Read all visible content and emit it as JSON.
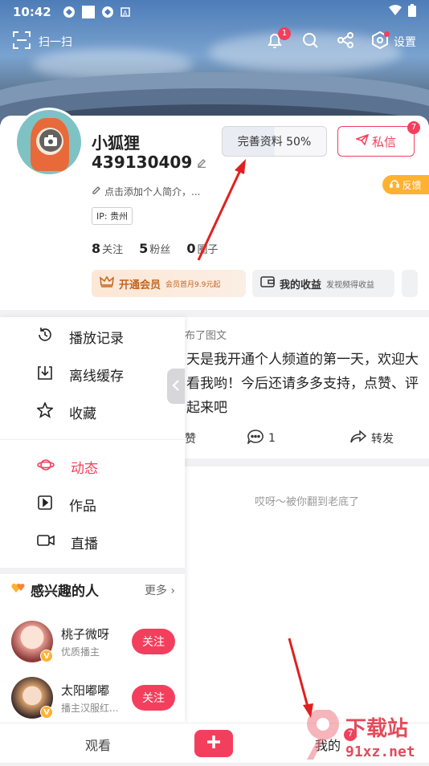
{
  "status_bar": {
    "time": "10:42"
  },
  "topbar": {
    "scan_label": "扫一扫",
    "notif_count": "1",
    "settings_label": "设置"
  },
  "profile": {
    "nickname": "小狐狸",
    "uid": "439130409",
    "bio_placeholder": "点击添加个人简介，...",
    "ip": "IP: 贵州",
    "complete_label": "完善资料 50%",
    "complete_progress": 0.5,
    "message_label": "私信",
    "message_badge": "7",
    "feedback_label": "反馈",
    "stats": [
      {
        "count": "8",
        "label": "关注"
      },
      {
        "count": "5",
        "label": "粉丝"
      },
      {
        "count": "0",
        "label": "圈子"
      }
    ],
    "vip": {
      "title": "开通会员",
      "subtitle": "会员首月9.9元起"
    },
    "earnings": {
      "title": "我的收益",
      "subtitle": "发视频得收益"
    }
  },
  "drawer": {
    "items_top": [
      "播放记录",
      "离线缓存",
      "收藏"
    ],
    "items_bottom": [
      "动态",
      "作品",
      "直播"
    ],
    "active_item": "动态",
    "interest_title": "感兴趣的人",
    "interest_more": "更多",
    "people": [
      {
        "name": "桃子微呀",
        "desc": "优质播主",
        "follow": "关注"
      },
      {
        "name": "太阳嘟嘟",
        "desc": "播主汉服红...",
        "follow": "关注"
      }
    ]
  },
  "feed": {
    "published": "布了图文",
    "content": "天是我开通个人频道的第一天，欢迎大看我哟！今后还请多多支持，点赞、评起来吧",
    "like_label": "赞",
    "comment_count": "1",
    "share_label": "转发",
    "end_text": "哎呀～被你翻到老底了"
  },
  "bottom_nav": {
    "watch": "观看",
    "mine": "我的",
    "mine_badge": "7"
  },
  "watermark": {
    "brand": "下载站",
    "domain": "91xz.net"
  },
  "colors": {
    "accent": "#f33f5d",
    "vip": "#c3641f",
    "feedback": "#ffb230"
  }
}
